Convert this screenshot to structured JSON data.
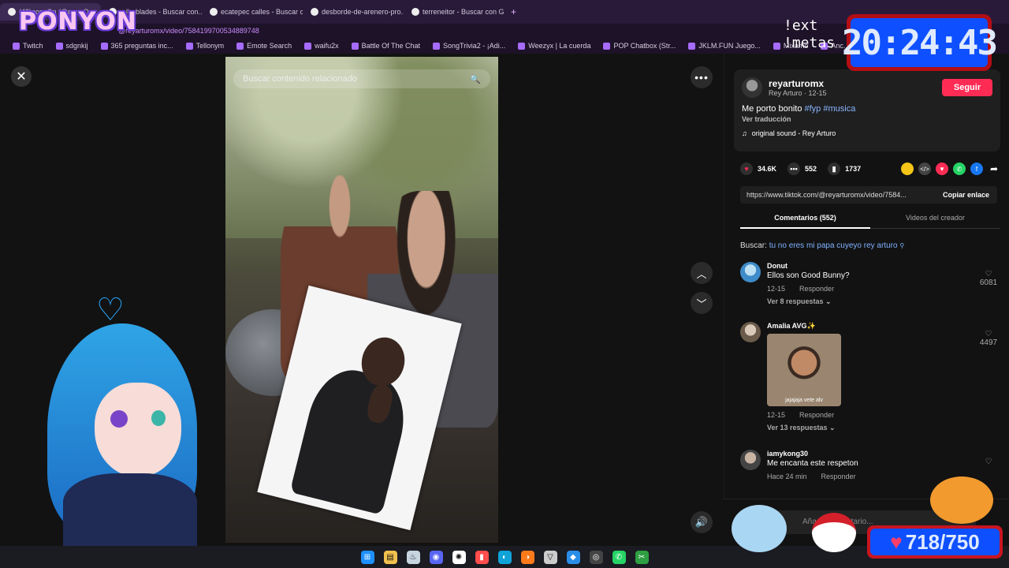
{
  "browser": {
    "tabs": [
      {
        "label": "(49)ponyOn (@ponyOn..."
      },
      {
        "label": "rollerblades - Buscar con..."
      },
      {
        "label": "ecatepec calles - Buscar c..."
      },
      {
        "label": "desborde-de-arenero-pro..."
      },
      {
        "label": "terreneitor - Buscar con G..."
      }
    ],
    "new_tab": "+",
    "url": "@reyarturomx/video/7584199700534889748",
    "bookmarks": [
      {
        "label": "Twitch"
      },
      {
        "label": "sdgnkij"
      },
      {
        "label": "365 preguntas inc..."
      },
      {
        "label": "Tellonym"
      },
      {
        "label": "Emote Search"
      },
      {
        "label": "waifu2x"
      },
      {
        "label": "Battle Of The Chat"
      },
      {
        "label": "SongTrivia2 - ¡Adi..."
      },
      {
        "label": "Weezyx | La cuerda"
      },
      {
        "label": "POP Chatbox (Str..."
      },
      {
        "label": "JKLM.FUN Juego..."
      },
      {
        "label": "Mixamo"
      },
      {
        "label": "Anc..."
      }
    ]
  },
  "viewer": {
    "close": "✕",
    "search_placeholder": "Buscar contenido relacionado",
    "search_icon": "🔍",
    "more": "•••",
    "nav_up": "︿",
    "nav_down": "﹀",
    "volume": "🔊"
  },
  "post": {
    "username": "reyarturomx",
    "subline": "Rey Arturo · 12-15",
    "follow": "Seguir",
    "caption_text": "Me porto bonito",
    "hashtags": [
      "#fyp",
      "#musica"
    ],
    "translate": "Ver traducción",
    "sound_icon": "♫",
    "sound": "original sound - Rey Arturo",
    "likes": "34.6K",
    "comments": "552",
    "saves": "1737",
    "link": "https://www.tiktok.com/@reyarturomx/video/7584...",
    "copy_link": "Copiar enlace",
    "tabs": [
      "Comentarios (552)",
      "Videos del creador"
    ],
    "search_label": "Buscar:",
    "search_query": "tu no eres mi papa cuyeyo rey arturo",
    "share_colors": [
      "#f5c518",
      "#444444",
      "#fe2c55",
      "#25d366",
      "#1877f2"
    ]
  },
  "comments": [
    {
      "user": "Donut",
      "text": "Ellos son Good Bunny?",
      "date": "12-15",
      "reply": "Responder",
      "replies": "Ver 8 respuestas ⌄",
      "likes": "6081"
    },
    {
      "user": "Amalia AVG✨",
      "image_caption": "jajajaja vete alv",
      "date": "12-15",
      "reply": "Responder",
      "replies": "Ver 13 respuestas ⌄",
      "likes": "4497"
    },
    {
      "user": "iamykong30",
      "text": "Me encanta este respeton",
      "date": "Hace 24 min",
      "reply": "Responder"
    }
  ],
  "comment_input": {
    "placeholder": "Añadir comentario..."
  },
  "overlay": {
    "logo": "PONYON",
    "clock": "20:24:43",
    "ext_line1": "!ext",
    "ext_line2": "!metas",
    "counter": "718/750",
    "counter_heart": "♥",
    "vt_heart": "♡"
  },
  "taskbar": {
    "icons": [
      "windows-icon",
      "folder-icon",
      "steam-icon",
      "discord-icon",
      "chatgpt-icon",
      "app-icon",
      "edge-icon",
      "firefox-icon",
      "vtube-icon",
      "vscode-icon",
      "obs-icon",
      "whatsapp-icon",
      "snip-icon"
    ],
    "glyphs": [
      "⊞",
      "▤",
      "♨",
      "◉",
      "✺",
      "▮",
      "◐",
      "◑",
      "▽",
      "◆",
      "◎",
      "✆",
      "✂"
    ],
    "colors": [
      "#1e90ff",
      "#f2c14e",
      "#c7d5e0",
      "#5865f2",
      "#ffffff",
      "#ff4d4d",
      "#0fa3d8",
      "#ff7a1a",
      "#cccccc",
      "#2a8ee8",
      "#444444",
      "#25d366",
      "#2ea043"
    ]
  }
}
